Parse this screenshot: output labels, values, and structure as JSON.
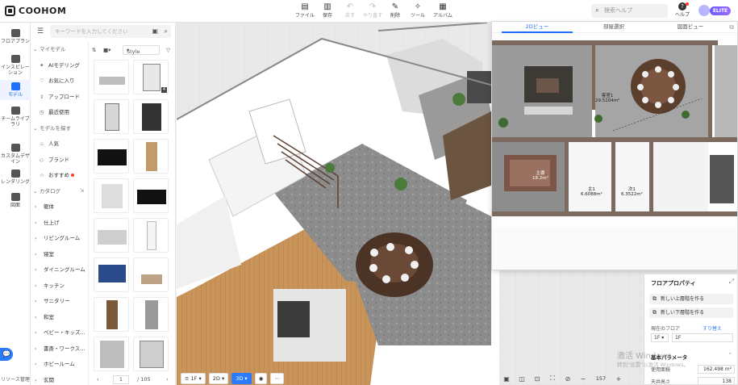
{
  "app": {
    "brand": "COOHOM",
    "user_badge": "ELITE",
    "help_search_placeholder": "検索ヘルプ",
    "help_label": "ヘルプ"
  },
  "toolbar": {
    "items": [
      {
        "label": "ファイル",
        "icon": "file-icon",
        "enabled": true
      },
      {
        "label": "保存",
        "icon": "save-icon",
        "enabled": true
      },
      {
        "label": "戻す",
        "icon": "undo-icon",
        "enabled": false
      },
      {
        "label": "やり直す",
        "icon": "redo-icon",
        "enabled": false
      },
      {
        "label": "削除",
        "icon": "delete-icon",
        "enabled": true
      },
      {
        "label": "ツール",
        "icon": "tool-icon",
        "enabled": true
      },
      {
        "label": "アルバム",
        "icon": "album-icon",
        "enabled": true
      }
    ]
  },
  "leftnav": {
    "items": [
      {
        "label1": "フロアプラン",
        "label2": ""
      },
      {
        "label1": "インスピレー",
        "label2": "ション"
      },
      {
        "label1": "モデル",
        "label2": "",
        "active": true
      },
      {
        "label1": "チームライブ",
        "label2": "ラリ"
      },
      {
        "label1": "カスタムデザ",
        "label2": "イン"
      },
      {
        "label1": "レンダリング",
        "label2": ""
      },
      {
        "label1": "図面",
        "label2": ""
      }
    ],
    "bottom_label": "リソース管理"
  },
  "modelpanel": {
    "search_placeholder": "キーワードを入力してください",
    "my_models_header": "マイモデル",
    "my_models": [
      "AIモデリング",
      "お気に入り",
      "アップロード",
      "最近使用"
    ],
    "find_header": "モデルを探す",
    "find_items": [
      "人気",
      "ブランド",
      "おすすめ"
    ],
    "catalog_header": "カタログ",
    "catalog_items": [
      "躯体",
      "仕上げ",
      "リビングルーム",
      "寝室",
      "ダイニングルーム",
      "キッチン",
      "サニタリー",
      "和室",
      "ベビー・キッズ...",
      "書斎・ワークス...",
      "ホビールーム",
      "玄関"
    ],
    "style_label": "Style",
    "thumb_badge": "4",
    "pager": {
      "current": "1",
      "total": "/ 105"
    }
  },
  "floor": {
    "floor_select": "1F",
    "view_2d": "2D",
    "view_3d": "3D"
  },
  "plan2d": {
    "tabs": [
      "2Dビュー",
      "部屋選択",
      "図面ビュー"
    ],
    "rooms": [
      {
        "name": "客室1",
        "area": "29.5104m²"
      },
      {
        "name": "主1",
        "area": "6.6088m²"
      },
      {
        "name": "次1",
        "area": "6.3522m²"
      },
      {
        "name": "主寝",
        "area": "18.2m²"
      }
    ]
  },
  "props": {
    "title": "フロアプロパティ",
    "btn_upper": "新しい上層階を作る",
    "btn_lower": "新しい下層階を作る",
    "current_floor_label": "現在のフロア",
    "current_floor_link": "すり替え",
    "floor_a": "1F",
    "floor_b": "1F",
    "section": "基本パラメータ",
    "area_label": "使用面積",
    "area_value": "162.498 m²",
    "height_label": "天井高さ",
    "height_value": "138"
  },
  "viewbar": {
    "zoom": "157"
  },
  "watermark": {
    "line1": "激活 Windows",
    "line2": "转到\"设置\"以激活 Windows。"
  }
}
